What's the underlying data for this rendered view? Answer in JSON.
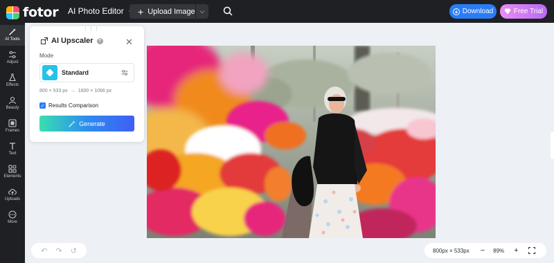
{
  "header": {
    "logo_text": "fotor",
    "editor_menu": "AI Photo Editor",
    "upload_label": "Upload Image",
    "download_label": "Download",
    "trial_label": "Free Trial",
    "colors": {
      "download": "#2a7cf6",
      "trial": "#c77cf3",
      "bar": "#1f2024"
    }
  },
  "sidebar": {
    "items": [
      {
        "label": "AI Tools",
        "icon": "magic-wand-icon"
      },
      {
        "label": "Adjust",
        "icon": "sliders-icon"
      },
      {
        "label": "Effects",
        "icon": "flask-icon"
      },
      {
        "label": "Beauty",
        "icon": "face-icon"
      },
      {
        "label": "Frames",
        "icon": "frame-icon"
      },
      {
        "label": "Text",
        "icon": "text-icon"
      },
      {
        "label": "Elements",
        "icon": "elements-icon"
      },
      {
        "label": "Uploads",
        "icon": "upload-cloud-icon"
      },
      {
        "label": "More",
        "icon": "more-icon"
      }
    ]
  },
  "panel": {
    "title": "AI Upscaler",
    "mode_label": "Mode",
    "mode_value": "Standard",
    "original_size": "800 × 533 px",
    "target_size": "1600 × 1066 px",
    "comparison_label": "Results Comparison",
    "comparison_checked": true,
    "generate_label": "Generate"
  },
  "footer": {
    "canvas_size": "800px × 533px",
    "zoom": "89%"
  }
}
